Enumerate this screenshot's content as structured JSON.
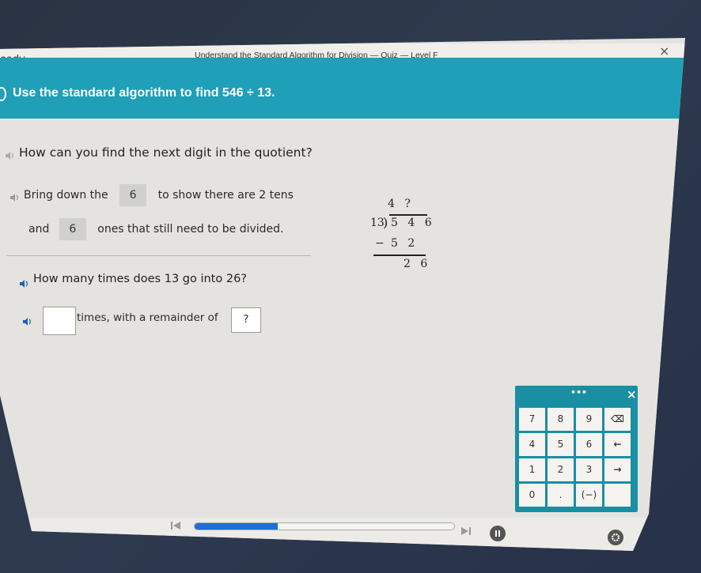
{
  "window": {
    "app_name": "eady",
    "lesson_title": "Understand the Standard Algorithm for Division — Quiz — Level F",
    "close_label": "×"
  },
  "banner": {
    "prompt": "Use the standard algorithm to find 546 ÷ 13."
  },
  "question1": {
    "text": "How can you find the next digit in the quotient?",
    "line1_before": "Bring down the",
    "line1_box": "6",
    "line1_after": "to show there are 2 tens",
    "line2_before": "and",
    "line2_box": "6",
    "line2_after": "ones that still need to be divided."
  },
  "division": {
    "quotient": "4 ?",
    "divisor": "13",
    "dividend": "5 4 6",
    "minus": "−",
    "subtrahend": "5 2",
    "remainder": "2 6"
  },
  "question2": {
    "text": "How many times does 13 go into 26?",
    "answer_value": "",
    "middle_text": "times, with a remainder of",
    "remainder_value": "?"
  },
  "keypad": {
    "menu_label": "•••",
    "close_label": "×",
    "keys": [
      "7",
      "8",
      "9",
      "⌫",
      "4",
      "5",
      "6",
      "←",
      "1",
      "2",
      "3",
      "→",
      "0",
      ".",
      "(−)",
      ""
    ]
  },
  "player": {
    "progress_percent": 32,
    "colors": {
      "accent": "#1e6fd4",
      "banner": "#1f9fb8",
      "keypad": "#198fa3"
    }
  }
}
